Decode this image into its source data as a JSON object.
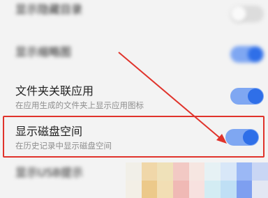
{
  "settings": [
    {
      "title": "显示隐藏目录",
      "subtitle": "",
      "toggle_on": false,
      "blurred": true
    },
    {
      "title": "显示缩略图",
      "subtitle": "",
      "toggle_on": true,
      "blurred": true
    },
    {
      "title": "文件夹关联应用",
      "subtitle": "在应用生成的文件夹上显示应用图标",
      "toggle_on": true,
      "blurred": false
    },
    {
      "title": "显示磁盘空间",
      "subtitle": "在历史记录中显示磁盘空间",
      "toggle_on": true,
      "blurred": false
    },
    {
      "title": "显示USB提示",
      "subtitle": "",
      "toggle_on": false,
      "blurred": true
    }
  ],
  "colors": {
    "toggle_track_on": "#7fa7f2",
    "toggle_knob_on": "#2f6fe8",
    "highlight": "#e0332b",
    "arrow": "#e0332b"
  }
}
